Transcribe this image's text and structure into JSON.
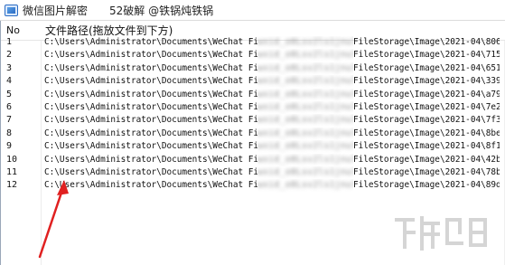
{
  "window": {
    "title": "微信图片解密　　52破解 @铁锅炖铁锅"
  },
  "table": {
    "columns": [
      {
        "label": "No"
      },
      {
        "label": "文件路径(拖放文件到下方)"
      }
    ],
    "rows": [
      {
        "no": "1",
        "path_start": "C:\\Users\\Administrator\\Documents\\WeChat Files",
        "path_hidden": "wxid_o0Lsv2ls1jnul",
        "path_end": "FileStorage\\Image\\2021-04\\806..."
      },
      {
        "no": "2",
        "path_start": "C:\\Users\\Administrator\\Documents\\WeChat Files",
        "path_hidden": "wxid_o0Lsv2ls1jnul",
        "path_end": "FileStorage\\Image\\2021-04\\715..."
      },
      {
        "no": "3",
        "path_start": "C:\\Users\\Administrator\\Documents\\WeChat Files",
        "path_hidden": "wxid_o0Lsv2ls1jnul",
        "path_end": "FileStorage\\Image\\2021-04\\651..."
      },
      {
        "no": "4",
        "path_start": "C:\\Users\\Administrator\\Documents\\WeChat Files",
        "path_hidden": "wxid_o0Lsv2ls1jnul",
        "path_end": "FileStorage\\Image\\2021-04\\339..."
      },
      {
        "no": "5",
        "path_start": "C:\\Users\\Administrator\\Documents\\WeChat Files",
        "path_hidden": "wxid_o0Lsv2ls1jnul",
        "path_end": "FileStorage\\Image\\2021-04\\a79..."
      },
      {
        "no": "6",
        "path_start": "C:\\Users\\Administrator\\Documents\\WeChat Files",
        "path_hidden": "wxid_o0Lsv2ls1jnul",
        "path_end": "FileStorage\\Image\\2021-04\\7e2..."
      },
      {
        "no": "7",
        "path_start": "C:\\Users\\Administrator\\Documents\\WeChat Files",
        "path_hidden": "wxid_o0Lsv2ls1jnul",
        "path_end": "FileStorage\\Image\\2021-04\\7f3..."
      },
      {
        "no": "8",
        "path_start": "C:\\Users\\Administrator\\Documents\\WeChat Files",
        "path_hidden": "wxid_o0Lsv2ls1jnul",
        "path_end": "FileStorage\\Image\\2021-04\\8be..."
      },
      {
        "no": "9",
        "path_start": "C:\\Users\\Administrator\\Documents\\WeChat Files",
        "path_hidden": "wxid_o0Lsv2ls1jnul",
        "path_end": "FileStorage\\Image\\2021-04\\8f1..."
      },
      {
        "no": "10",
        "path_start": "C:\\Users\\Administrator\\Documents\\WeChat Files",
        "path_hidden": "wxid_o0Lsv2ls1jnul",
        "path_end": "FileStorage\\Image\\2021-04\\42b..."
      },
      {
        "no": "11",
        "path_start": "C:\\Users\\Administrator\\Documents\\WeChat Files",
        "path_hidden": "wxid_o0Lsv2ls1jnul",
        "path_end": "FileStorage\\Image\\2021-04\\78b..."
      },
      {
        "no": "12",
        "path_start": "C:\\Users\\Administrator\\Documents\\WeChat Files",
        "path_hidden": "wxid_o0Lsv2ls1jnul",
        "path_end": "FileStorage\\Image\\2021-04\\89d..."
      }
    ]
  },
  "annotation": {
    "color": "#e02020"
  },
  "colors": {
    "title_bar": "#ffffff",
    "header_border": "#e6e6e6",
    "app_icon_accent": "#2b6cc4"
  },
  "icons": [
    "app-icon",
    "red-arrow-annotation"
  ]
}
